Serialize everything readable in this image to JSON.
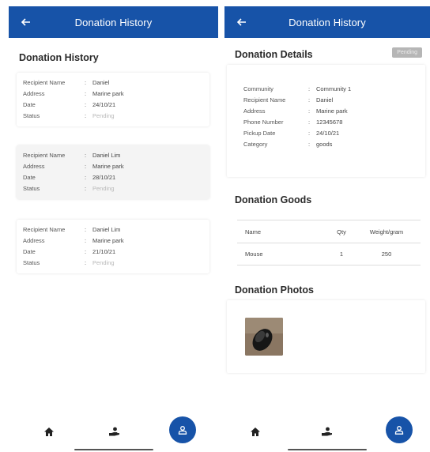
{
  "left_screen": {
    "appbar": {
      "title": "Donation History",
      "back_icon": "arrow-left-icon"
    },
    "section_title": "Donation History",
    "labels": {
      "recipient": "Recipient Name",
      "address": "Address",
      "date": "Date",
      "status": "Status",
      "colon": ":"
    },
    "donations": [
      {
        "recipient": "Daniel",
        "address": "Marine park",
        "date": "24/10/21",
        "status": "Pending"
      },
      {
        "recipient": "Daniel Lim",
        "address": "Marine park",
        "date": "28/10/21",
        "status": "Pending"
      },
      {
        "recipient": "Daniel Lim",
        "address": "Marine park",
        "date": "21/10/21",
        "status": "Pending"
      }
    ]
  },
  "right_screen": {
    "appbar": {
      "title": "Donation History",
      "back_icon": "arrow-left-icon"
    },
    "details_title": "Donation Details",
    "status_badge": "Pending",
    "details": {
      "community_label": "Community",
      "community": "Community 1",
      "recipient_label": "Recipient Name",
      "recipient": "Daniel",
      "address_label": "Address",
      "address": "Marine park",
      "phone_label": "Phone Number",
      "phone": "12345678",
      "pickup_label": "Pickup Date",
      "pickup": "24/10/21",
      "category_label": "Category",
      "category": "goods",
      "colon": ":"
    },
    "goods_title": "Donation Goods",
    "goods_table": {
      "headers": [
        "Name",
        "Qty",
        "Weight/gram"
      ],
      "rows": [
        [
          "Mouse",
          "1",
          "250"
        ]
      ]
    },
    "photos_title": "Donation Photos",
    "photo_icon": "mouse-photo"
  },
  "bottom_nav": {
    "items": [
      {
        "name": "home",
        "icon": "home-icon"
      },
      {
        "name": "donate",
        "icon": "hand-person-icon"
      },
      {
        "name": "profile",
        "icon": "profile-icon"
      }
    ]
  },
  "colors": {
    "primary": "#1753a8",
    "badge": "#b6b6b6",
    "pending": "#b9b9b9"
  }
}
